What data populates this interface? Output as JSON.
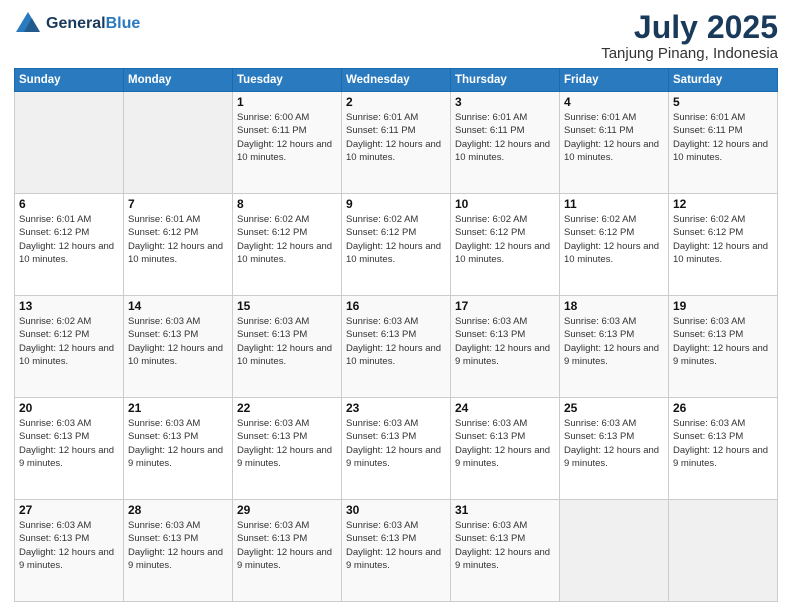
{
  "logo": {
    "general": "General",
    "blue": "Blue"
  },
  "header": {
    "month": "July 2025",
    "location": "Tanjung Pinang, Indonesia"
  },
  "weekdays": [
    "Sunday",
    "Monday",
    "Tuesday",
    "Wednesday",
    "Thursday",
    "Friday",
    "Saturday"
  ],
  "weeks": [
    [
      {
        "day": "",
        "sunrise": "",
        "sunset": "",
        "daylight": ""
      },
      {
        "day": "",
        "sunrise": "",
        "sunset": "",
        "daylight": ""
      },
      {
        "day": "1",
        "sunrise": "Sunrise: 6:00 AM",
        "sunset": "Sunset: 6:11 PM",
        "daylight": "Daylight: 12 hours and 10 minutes."
      },
      {
        "day": "2",
        "sunrise": "Sunrise: 6:01 AM",
        "sunset": "Sunset: 6:11 PM",
        "daylight": "Daylight: 12 hours and 10 minutes."
      },
      {
        "day": "3",
        "sunrise": "Sunrise: 6:01 AM",
        "sunset": "Sunset: 6:11 PM",
        "daylight": "Daylight: 12 hours and 10 minutes."
      },
      {
        "day": "4",
        "sunrise": "Sunrise: 6:01 AM",
        "sunset": "Sunset: 6:11 PM",
        "daylight": "Daylight: 12 hours and 10 minutes."
      },
      {
        "day": "5",
        "sunrise": "Sunrise: 6:01 AM",
        "sunset": "Sunset: 6:11 PM",
        "daylight": "Daylight: 12 hours and 10 minutes."
      }
    ],
    [
      {
        "day": "6",
        "sunrise": "Sunrise: 6:01 AM",
        "sunset": "Sunset: 6:12 PM",
        "daylight": "Daylight: 12 hours and 10 minutes."
      },
      {
        "day": "7",
        "sunrise": "Sunrise: 6:01 AM",
        "sunset": "Sunset: 6:12 PM",
        "daylight": "Daylight: 12 hours and 10 minutes."
      },
      {
        "day": "8",
        "sunrise": "Sunrise: 6:02 AM",
        "sunset": "Sunset: 6:12 PM",
        "daylight": "Daylight: 12 hours and 10 minutes."
      },
      {
        "day": "9",
        "sunrise": "Sunrise: 6:02 AM",
        "sunset": "Sunset: 6:12 PM",
        "daylight": "Daylight: 12 hours and 10 minutes."
      },
      {
        "day": "10",
        "sunrise": "Sunrise: 6:02 AM",
        "sunset": "Sunset: 6:12 PM",
        "daylight": "Daylight: 12 hours and 10 minutes."
      },
      {
        "day": "11",
        "sunrise": "Sunrise: 6:02 AM",
        "sunset": "Sunset: 6:12 PM",
        "daylight": "Daylight: 12 hours and 10 minutes."
      },
      {
        "day": "12",
        "sunrise": "Sunrise: 6:02 AM",
        "sunset": "Sunset: 6:12 PM",
        "daylight": "Daylight: 12 hours and 10 minutes."
      }
    ],
    [
      {
        "day": "13",
        "sunrise": "Sunrise: 6:02 AM",
        "sunset": "Sunset: 6:12 PM",
        "daylight": "Daylight: 12 hours and 10 minutes."
      },
      {
        "day": "14",
        "sunrise": "Sunrise: 6:03 AM",
        "sunset": "Sunset: 6:13 PM",
        "daylight": "Daylight: 12 hours and 10 minutes."
      },
      {
        "day": "15",
        "sunrise": "Sunrise: 6:03 AM",
        "sunset": "Sunset: 6:13 PM",
        "daylight": "Daylight: 12 hours and 10 minutes."
      },
      {
        "day": "16",
        "sunrise": "Sunrise: 6:03 AM",
        "sunset": "Sunset: 6:13 PM",
        "daylight": "Daylight: 12 hours and 10 minutes."
      },
      {
        "day": "17",
        "sunrise": "Sunrise: 6:03 AM",
        "sunset": "Sunset: 6:13 PM",
        "daylight": "Daylight: 12 hours and 9 minutes."
      },
      {
        "day": "18",
        "sunrise": "Sunrise: 6:03 AM",
        "sunset": "Sunset: 6:13 PM",
        "daylight": "Daylight: 12 hours and 9 minutes."
      },
      {
        "day": "19",
        "sunrise": "Sunrise: 6:03 AM",
        "sunset": "Sunset: 6:13 PM",
        "daylight": "Daylight: 12 hours and 9 minutes."
      }
    ],
    [
      {
        "day": "20",
        "sunrise": "Sunrise: 6:03 AM",
        "sunset": "Sunset: 6:13 PM",
        "daylight": "Daylight: 12 hours and 9 minutes."
      },
      {
        "day": "21",
        "sunrise": "Sunrise: 6:03 AM",
        "sunset": "Sunset: 6:13 PM",
        "daylight": "Daylight: 12 hours and 9 minutes."
      },
      {
        "day": "22",
        "sunrise": "Sunrise: 6:03 AM",
        "sunset": "Sunset: 6:13 PM",
        "daylight": "Daylight: 12 hours and 9 minutes."
      },
      {
        "day": "23",
        "sunrise": "Sunrise: 6:03 AM",
        "sunset": "Sunset: 6:13 PM",
        "daylight": "Daylight: 12 hours and 9 minutes."
      },
      {
        "day": "24",
        "sunrise": "Sunrise: 6:03 AM",
        "sunset": "Sunset: 6:13 PM",
        "daylight": "Daylight: 12 hours and 9 minutes."
      },
      {
        "day": "25",
        "sunrise": "Sunrise: 6:03 AM",
        "sunset": "Sunset: 6:13 PM",
        "daylight": "Daylight: 12 hours and 9 minutes."
      },
      {
        "day": "26",
        "sunrise": "Sunrise: 6:03 AM",
        "sunset": "Sunset: 6:13 PM",
        "daylight": "Daylight: 12 hours and 9 minutes."
      }
    ],
    [
      {
        "day": "27",
        "sunrise": "Sunrise: 6:03 AM",
        "sunset": "Sunset: 6:13 PM",
        "daylight": "Daylight: 12 hours and 9 minutes."
      },
      {
        "day": "28",
        "sunrise": "Sunrise: 6:03 AM",
        "sunset": "Sunset: 6:13 PM",
        "daylight": "Daylight: 12 hours and 9 minutes."
      },
      {
        "day": "29",
        "sunrise": "Sunrise: 6:03 AM",
        "sunset": "Sunset: 6:13 PM",
        "daylight": "Daylight: 12 hours and 9 minutes."
      },
      {
        "day": "30",
        "sunrise": "Sunrise: 6:03 AM",
        "sunset": "Sunset: 6:13 PM",
        "daylight": "Daylight: 12 hours and 9 minutes."
      },
      {
        "day": "31",
        "sunrise": "Sunrise: 6:03 AM",
        "sunset": "Sunset: 6:13 PM",
        "daylight": "Daylight: 12 hours and 9 minutes."
      },
      {
        "day": "",
        "sunrise": "",
        "sunset": "",
        "daylight": ""
      },
      {
        "day": "",
        "sunrise": "",
        "sunset": "",
        "daylight": ""
      }
    ]
  ]
}
